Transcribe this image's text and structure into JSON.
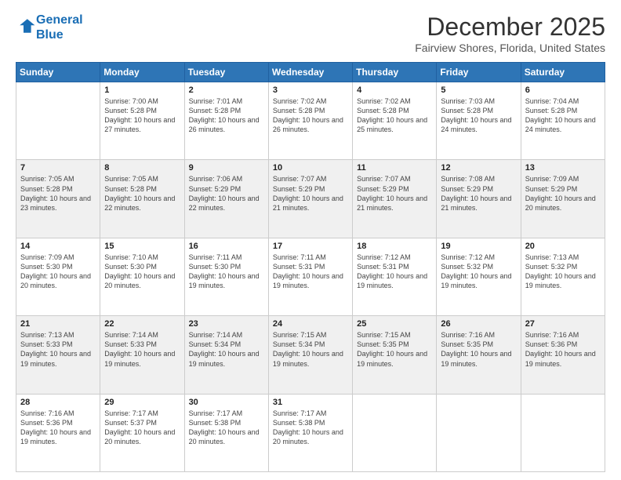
{
  "logo": {
    "line1": "General",
    "line2": "Blue"
  },
  "title": "December 2025",
  "location": "Fairview Shores, Florida, United States",
  "days_header": [
    "Sunday",
    "Monday",
    "Tuesday",
    "Wednesday",
    "Thursday",
    "Friday",
    "Saturday"
  ],
  "weeks": [
    [
      {
        "day": "",
        "sunrise": "",
        "sunset": "",
        "daylight": ""
      },
      {
        "day": "1",
        "sunrise": "Sunrise: 7:00 AM",
        "sunset": "Sunset: 5:28 PM",
        "daylight": "Daylight: 10 hours and 27 minutes."
      },
      {
        "day": "2",
        "sunrise": "Sunrise: 7:01 AM",
        "sunset": "Sunset: 5:28 PM",
        "daylight": "Daylight: 10 hours and 26 minutes."
      },
      {
        "day": "3",
        "sunrise": "Sunrise: 7:02 AM",
        "sunset": "Sunset: 5:28 PM",
        "daylight": "Daylight: 10 hours and 26 minutes."
      },
      {
        "day": "4",
        "sunrise": "Sunrise: 7:02 AM",
        "sunset": "Sunset: 5:28 PM",
        "daylight": "Daylight: 10 hours and 25 minutes."
      },
      {
        "day": "5",
        "sunrise": "Sunrise: 7:03 AM",
        "sunset": "Sunset: 5:28 PM",
        "daylight": "Daylight: 10 hours and 24 minutes."
      },
      {
        "day": "6",
        "sunrise": "Sunrise: 7:04 AM",
        "sunset": "Sunset: 5:28 PM",
        "daylight": "Daylight: 10 hours and 24 minutes."
      }
    ],
    [
      {
        "day": "7",
        "sunrise": "Sunrise: 7:05 AM",
        "sunset": "Sunset: 5:28 PM",
        "daylight": "Daylight: 10 hours and 23 minutes."
      },
      {
        "day": "8",
        "sunrise": "Sunrise: 7:05 AM",
        "sunset": "Sunset: 5:28 PM",
        "daylight": "Daylight: 10 hours and 22 minutes."
      },
      {
        "day": "9",
        "sunrise": "Sunrise: 7:06 AM",
        "sunset": "Sunset: 5:29 PM",
        "daylight": "Daylight: 10 hours and 22 minutes."
      },
      {
        "day": "10",
        "sunrise": "Sunrise: 7:07 AM",
        "sunset": "Sunset: 5:29 PM",
        "daylight": "Daylight: 10 hours and 21 minutes."
      },
      {
        "day": "11",
        "sunrise": "Sunrise: 7:07 AM",
        "sunset": "Sunset: 5:29 PM",
        "daylight": "Daylight: 10 hours and 21 minutes."
      },
      {
        "day": "12",
        "sunrise": "Sunrise: 7:08 AM",
        "sunset": "Sunset: 5:29 PM",
        "daylight": "Daylight: 10 hours and 21 minutes."
      },
      {
        "day": "13",
        "sunrise": "Sunrise: 7:09 AM",
        "sunset": "Sunset: 5:29 PM",
        "daylight": "Daylight: 10 hours and 20 minutes."
      }
    ],
    [
      {
        "day": "14",
        "sunrise": "Sunrise: 7:09 AM",
        "sunset": "Sunset: 5:30 PM",
        "daylight": "Daylight: 10 hours and 20 minutes."
      },
      {
        "day": "15",
        "sunrise": "Sunrise: 7:10 AM",
        "sunset": "Sunset: 5:30 PM",
        "daylight": "Daylight: 10 hours and 20 minutes."
      },
      {
        "day": "16",
        "sunrise": "Sunrise: 7:11 AM",
        "sunset": "Sunset: 5:30 PM",
        "daylight": "Daylight: 10 hours and 19 minutes."
      },
      {
        "day": "17",
        "sunrise": "Sunrise: 7:11 AM",
        "sunset": "Sunset: 5:31 PM",
        "daylight": "Daylight: 10 hours and 19 minutes."
      },
      {
        "day": "18",
        "sunrise": "Sunrise: 7:12 AM",
        "sunset": "Sunset: 5:31 PM",
        "daylight": "Daylight: 10 hours and 19 minutes."
      },
      {
        "day": "19",
        "sunrise": "Sunrise: 7:12 AM",
        "sunset": "Sunset: 5:32 PM",
        "daylight": "Daylight: 10 hours and 19 minutes."
      },
      {
        "day": "20",
        "sunrise": "Sunrise: 7:13 AM",
        "sunset": "Sunset: 5:32 PM",
        "daylight": "Daylight: 10 hours and 19 minutes."
      }
    ],
    [
      {
        "day": "21",
        "sunrise": "Sunrise: 7:13 AM",
        "sunset": "Sunset: 5:33 PM",
        "daylight": "Daylight: 10 hours and 19 minutes."
      },
      {
        "day": "22",
        "sunrise": "Sunrise: 7:14 AM",
        "sunset": "Sunset: 5:33 PM",
        "daylight": "Daylight: 10 hours and 19 minutes."
      },
      {
        "day": "23",
        "sunrise": "Sunrise: 7:14 AM",
        "sunset": "Sunset: 5:34 PM",
        "daylight": "Daylight: 10 hours and 19 minutes."
      },
      {
        "day": "24",
        "sunrise": "Sunrise: 7:15 AM",
        "sunset": "Sunset: 5:34 PM",
        "daylight": "Daylight: 10 hours and 19 minutes."
      },
      {
        "day": "25",
        "sunrise": "Sunrise: 7:15 AM",
        "sunset": "Sunset: 5:35 PM",
        "daylight": "Daylight: 10 hours and 19 minutes."
      },
      {
        "day": "26",
        "sunrise": "Sunrise: 7:16 AM",
        "sunset": "Sunset: 5:35 PM",
        "daylight": "Daylight: 10 hours and 19 minutes."
      },
      {
        "day": "27",
        "sunrise": "Sunrise: 7:16 AM",
        "sunset": "Sunset: 5:36 PM",
        "daylight": "Daylight: 10 hours and 19 minutes."
      }
    ],
    [
      {
        "day": "28",
        "sunrise": "Sunrise: 7:16 AM",
        "sunset": "Sunset: 5:36 PM",
        "daylight": "Daylight: 10 hours and 19 minutes."
      },
      {
        "day": "29",
        "sunrise": "Sunrise: 7:17 AM",
        "sunset": "Sunset: 5:37 PM",
        "daylight": "Daylight: 10 hours and 20 minutes."
      },
      {
        "day": "30",
        "sunrise": "Sunrise: 7:17 AM",
        "sunset": "Sunset: 5:38 PM",
        "daylight": "Daylight: 10 hours and 20 minutes."
      },
      {
        "day": "31",
        "sunrise": "Sunrise: 7:17 AM",
        "sunset": "Sunset: 5:38 PM",
        "daylight": "Daylight: 10 hours and 20 minutes."
      },
      {
        "day": "",
        "sunrise": "",
        "sunset": "",
        "daylight": ""
      },
      {
        "day": "",
        "sunrise": "",
        "sunset": "",
        "daylight": ""
      },
      {
        "day": "",
        "sunrise": "",
        "sunset": "",
        "daylight": ""
      }
    ]
  ]
}
